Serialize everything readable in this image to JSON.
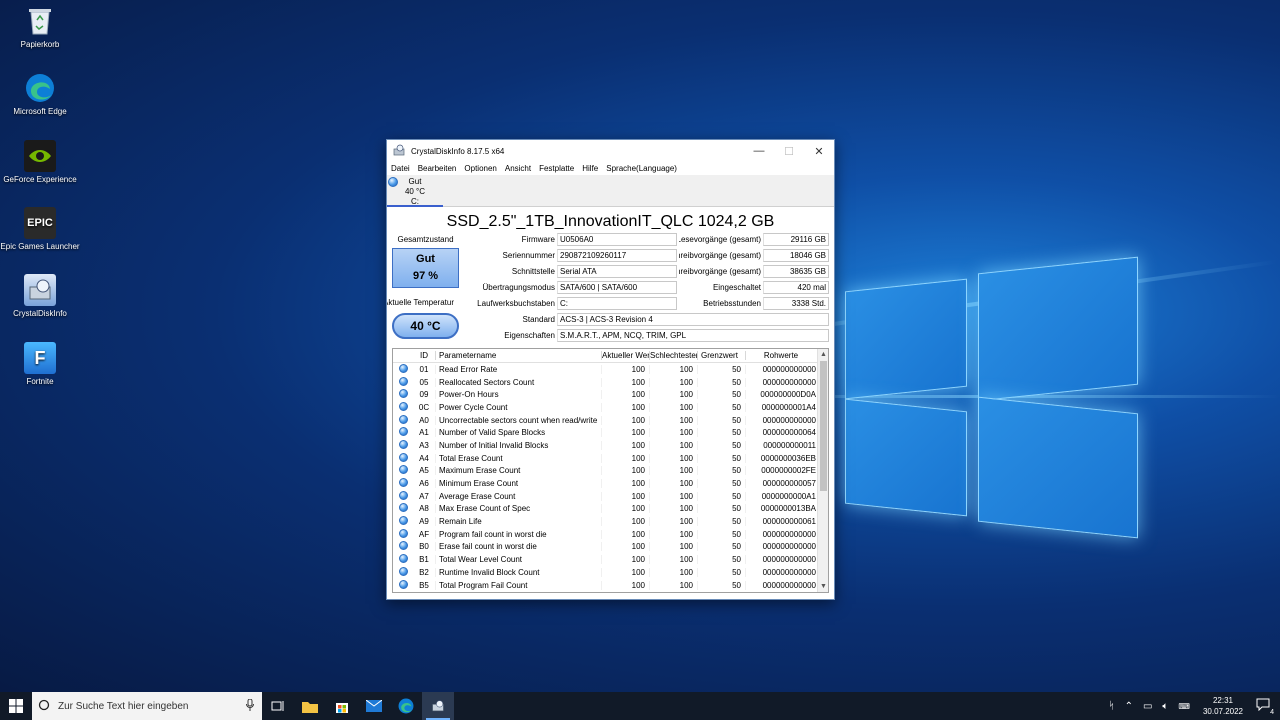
{
  "desktop_icons": [
    {
      "label": "Papierkorb",
      "icon": "recycle-bin-icon"
    },
    {
      "label": "Microsoft Edge",
      "icon": "edge-icon"
    },
    {
      "label": "GeForce Experience",
      "icon": "geforce-icon"
    },
    {
      "label": "Epic Games Launcher",
      "icon": "epic-icon",
      "logo_text": "EPIC"
    },
    {
      "label": "CrystalDiskInfo",
      "icon": "crystaldiskinfo-icon"
    },
    {
      "label": "Fortnite",
      "icon": "fortnite-icon",
      "logo_text": "F"
    }
  ],
  "window": {
    "title": "CrystalDiskInfo 8.17.5 x64",
    "menu": [
      "Datei",
      "Bearbeiten",
      "Optionen",
      "Ansicht",
      "Festplatte",
      "Hilfe",
      "Sprache(Language)"
    ],
    "drive_tab": {
      "status": "Gut",
      "temp": "40 °C",
      "letter": "C:"
    },
    "model": "SSD_2.5\"_1TB_InnovationIT_QLC 1024,2 GB",
    "health_label": "Gesamtzustand",
    "health_status": "Gut",
    "health_percent": "97 %",
    "temp_label": "Aktuelle Temperatur",
    "temp_value": "40 °C",
    "labels": {
      "firmware": "Firmware",
      "serial": "Seriennummer",
      "interface": "Schnittstelle",
      "transfer": "Übertragungsmodus",
      "drive_letters": "Laufwerksbuchstaben",
      "standard": "Standard",
      "features": "Eigenschaften",
      "host_reads": "Host-Lesevorgänge (gesamt)",
      "host_writes": "Host-Schreibvorgänge (gesamt)",
      "nand_writes": "NAND-Schreibvorgänge (gesamt)",
      "power_count": "Eingeschaltet",
      "power_hours": "Betriebsstunden"
    },
    "values": {
      "firmware": "U0506A0",
      "serial": "290872109260117",
      "interface": "Serial ATA",
      "transfer": "SATA/600 | SATA/600",
      "drive_letters": "C:",
      "standard": "ACS-3 | ACS-3 Revision 4",
      "features": "S.M.A.R.T., APM, NCQ, TRIM, GPL",
      "host_reads": "29116 GB",
      "host_writes": "18046 GB",
      "nand_writes": "38635 GB",
      "power_count": "420 mal",
      "power_hours": "3338 Std."
    },
    "table": {
      "headers": [
        "ID",
        "Parametername",
        "Aktueller Wert",
        "Schlechtester Wert",
        "Grenzwert",
        "Rohwerte"
      ],
      "rows": [
        [
          "01",
          "Read Error Rate",
          "100",
          "100",
          "50",
          "000000000000"
        ],
        [
          "05",
          "Reallocated Sectors Count",
          "100",
          "100",
          "50",
          "000000000000"
        ],
        [
          "09",
          "Power-On Hours",
          "100",
          "100",
          "50",
          "000000000D0A"
        ],
        [
          "0C",
          "Power Cycle Count",
          "100",
          "100",
          "50",
          "0000000001A4"
        ],
        [
          "A0",
          "Uncorrectable sectors count when read/write",
          "100",
          "100",
          "50",
          "000000000000"
        ],
        [
          "A1",
          "Number of Valid Spare Blocks",
          "100",
          "100",
          "50",
          "000000000064"
        ],
        [
          "A3",
          "Number of Initial Invalid Blocks",
          "100",
          "100",
          "50",
          "000000000011"
        ],
        [
          "A4",
          "Total Erase Count",
          "100",
          "100",
          "50",
          "0000000036EB"
        ],
        [
          "A5",
          "Maximum Erase Count",
          "100",
          "100",
          "50",
          "0000000002FE"
        ],
        [
          "A6",
          "Minimum Erase Count",
          "100",
          "100",
          "50",
          "000000000057"
        ],
        [
          "A7",
          "Average Erase Count",
          "100",
          "100",
          "50",
          "0000000000A1"
        ],
        [
          "A8",
          "Max Erase Count of Spec",
          "100",
          "100",
          "50",
          "0000000013BA"
        ],
        [
          "A9",
          "Remain Life",
          "100",
          "100",
          "50",
          "000000000061"
        ],
        [
          "AF",
          "Program fail count in worst die",
          "100",
          "100",
          "50",
          "000000000000"
        ],
        [
          "B0",
          "Erase fail count in worst die",
          "100",
          "100",
          "50",
          "000000000000"
        ],
        [
          "B1",
          "Total Wear Level Count",
          "100",
          "100",
          "50",
          "000000000000"
        ],
        [
          "B2",
          "Runtime Invalid Block Count",
          "100",
          "100",
          "50",
          "000000000000"
        ],
        [
          "B5",
          "Total Program Fail Count",
          "100",
          "100",
          "50",
          "000000000000"
        ]
      ]
    }
  },
  "taskbar": {
    "search_placeholder": "Zur Suche Text hier eingeben",
    "time": "22:31",
    "date": "30.07.2022",
    "notification_count": "4"
  },
  "colors": {
    "accent": "#3a5fcd",
    "health_blue": "#7fb0ee",
    "taskbar": "#111a28"
  }
}
